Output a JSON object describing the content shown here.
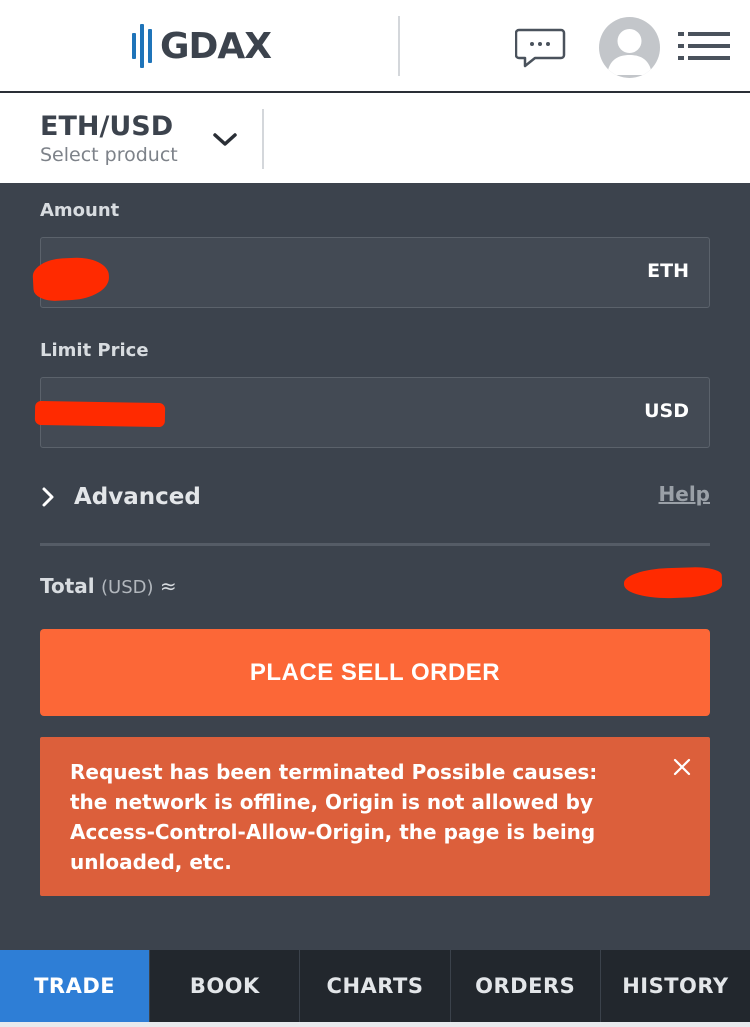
{
  "header": {
    "logo_text": "GDAX",
    "icons": [
      "chat-icon",
      "user-avatar-icon",
      "hamburger-menu-icon"
    ]
  },
  "product": {
    "name": "ETH/USD",
    "subtitle": "Select product"
  },
  "form": {
    "amount": {
      "label": "Amount",
      "value": "",
      "unit": "ETH",
      "redacted": true
    },
    "limit_price": {
      "label": "Limit Price",
      "value": "",
      "unit": "USD",
      "redacted": true
    },
    "advanced_label": "Advanced",
    "help_label": "Help",
    "total": {
      "label": "Total",
      "currency": "(USD)",
      "approx": "≈",
      "value_redacted": true
    }
  },
  "actions": {
    "place_order_label": "PLACE SELL ORDER"
  },
  "error": {
    "message": "Request has been terminated Possible causes: the network is offline, Origin is not allowed by Access-Control-Allow-Origin, the page is being unloaded, etc."
  },
  "tabs": [
    {
      "label": "TRADE",
      "active": true
    },
    {
      "label": "BOOK",
      "active": false
    },
    {
      "label": "CHARTS",
      "active": false
    },
    {
      "label": "ORDERS",
      "active": false
    },
    {
      "label": "HISTORY",
      "active": false
    }
  ],
  "colors": {
    "brand_blue": "#1f74b9",
    "sell_orange": "#fc6737",
    "error_orange": "#dc5f3b",
    "active_tab": "#2e7ed6",
    "panel_bg": "#3c434d",
    "redaction": "#ff2a00"
  }
}
